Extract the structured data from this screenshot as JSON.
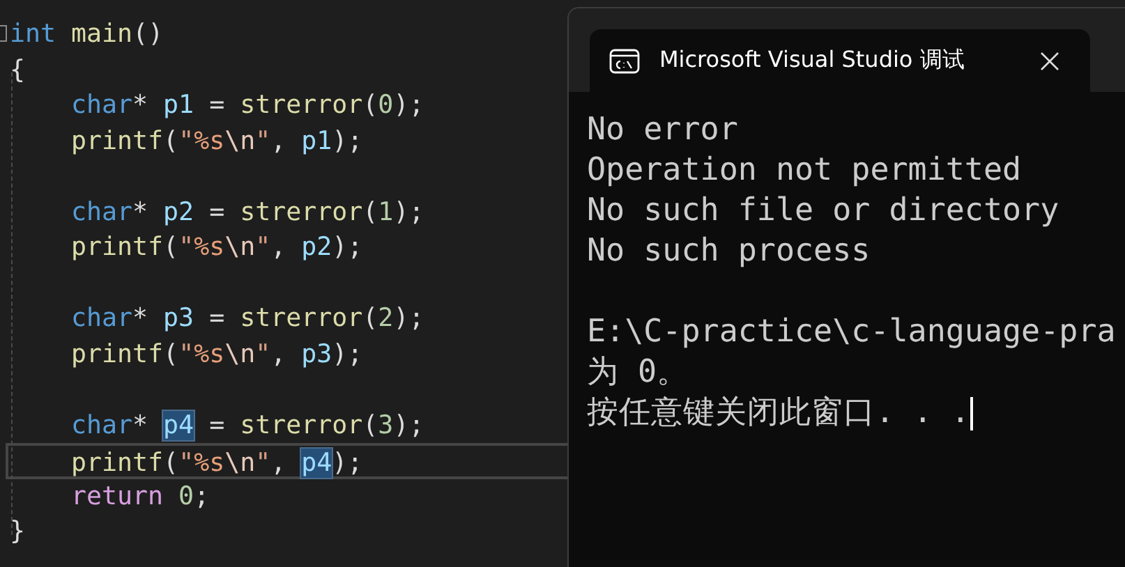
{
  "editor": {
    "function": {
      "header": [
        {
          "kind": "keyword",
          "text": "int "
        },
        {
          "kind": "function",
          "text": "main"
        },
        {
          "kind": "plain",
          "text": "()"
        }
      ],
      "open": "{",
      "body": [
        {
          "kind": "code",
          "current": false,
          "tokens": [
            {
              "kind": "keyword",
              "text": "char"
            },
            {
              "kind": "plain",
              "text": "* "
            },
            {
              "kind": "variable",
              "text": "p1",
              "highlighted": false
            },
            {
              "kind": "plain",
              "text": " = "
            },
            {
              "kind": "function",
              "text": "strerror"
            },
            {
              "kind": "plain",
              "text": "("
            },
            {
              "kind": "number",
              "text": "0"
            },
            {
              "kind": "plain",
              "text": ");"
            }
          ]
        },
        {
          "kind": "code",
          "current": false,
          "tokens": [
            {
              "kind": "function",
              "text": "printf"
            },
            {
              "kind": "plain",
              "text": "("
            },
            {
              "kind": "string",
              "text": "\""
            },
            {
              "kind": "format",
              "text": "%s"
            },
            {
              "kind": "escape",
              "text": "\\n"
            },
            {
              "kind": "string",
              "text": "\""
            },
            {
              "kind": "plain",
              "text": ", "
            },
            {
              "kind": "variable",
              "text": "p1",
              "highlighted": false
            },
            {
              "kind": "plain",
              "text": ");"
            }
          ]
        },
        {
          "kind": "blank"
        },
        {
          "kind": "code",
          "current": false,
          "tokens": [
            {
              "kind": "keyword",
              "text": "char"
            },
            {
              "kind": "plain",
              "text": "* "
            },
            {
              "kind": "variable",
              "text": "p2",
              "highlighted": false
            },
            {
              "kind": "plain",
              "text": " = "
            },
            {
              "kind": "function",
              "text": "strerror"
            },
            {
              "kind": "plain",
              "text": "("
            },
            {
              "kind": "number",
              "text": "1"
            },
            {
              "kind": "plain",
              "text": ");"
            }
          ]
        },
        {
          "kind": "code",
          "current": false,
          "tokens": [
            {
              "kind": "function",
              "text": "printf"
            },
            {
              "kind": "plain",
              "text": "("
            },
            {
              "kind": "string",
              "text": "\""
            },
            {
              "kind": "format",
              "text": "%s"
            },
            {
              "kind": "escape",
              "text": "\\n"
            },
            {
              "kind": "string",
              "text": "\""
            },
            {
              "kind": "plain",
              "text": ", "
            },
            {
              "kind": "variable",
              "text": "p2",
              "highlighted": false
            },
            {
              "kind": "plain",
              "text": ");"
            }
          ]
        },
        {
          "kind": "blank"
        },
        {
          "kind": "code",
          "current": false,
          "tokens": [
            {
              "kind": "keyword",
              "text": "char"
            },
            {
              "kind": "plain",
              "text": "* "
            },
            {
              "kind": "variable",
              "text": "p3",
              "highlighted": false
            },
            {
              "kind": "plain",
              "text": " = "
            },
            {
              "kind": "function",
              "text": "strerror"
            },
            {
              "kind": "plain",
              "text": "("
            },
            {
              "kind": "number",
              "text": "2"
            },
            {
              "kind": "plain",
              "text": ");"
            }
          ]
        },
        {
          "kind": "code",
          "current": false,
          "tokens": [
            {
              "kind": "function",
              "text": "printf"
            },
            {
              "kind": "plain",
              "text": "("
            },
            {
              "kind": "string",
              "text": "\""
            },
            {
              "kind": "format",
              "text": "%s"
            },
            {
              "kind": "escape",
              "text": "\\n"
            },
            {
              "kind": "string",
              "text": "\""
            },
            {
              "kind": "plain",
              "text": ", "
            },
            {
              "kind": "variable",
              "text": "p3",
              "highlighted": false
            },
            {
              "kind": "plain",
              "text": ");"
            }
          ]
        },
        {
          "kind": "blank"
        },
        {
          "kind": "code",
          "current": false,
          "tokens": [
            {
              "kind": "keyword",
              "text": "char"
            },
            {
              "kind": "plain",
              "text": "* "
            },
            {
              "kind": "variable",
              "text": "p4",
              "highlighted": true
            },
            {
              "kind": "plain",
              "text": " = "
            },
            {
              "kind": "function",
              "text": "strerror"
            },
            {
              "kind": "plain",
              "text": "("
            },
            {
              "kind": "number",
              "text": "3"
            },
            {
              "kind": "plain",
              "text": ");"
            }
          ]
        },
        {
          "kind": "code",
          "current": true,
          "tokens": [
            {
              "kind": "function",
              "text": "printf"
            },
            {
              "kind": "plain",
              "text": "("
            },
            {
              "kind": "string",
              "text": "\""
            },
            {
              "kind": "format",
              "text": "%s"
            },
            {
              "kind": "escape",
              "text": "\\n"
            },
            {
              "kind": "string",
              "text": "\""
            },
            {
              "kind": "plain",
              "text": ", "
            },
            {
              "kind": "variable",
              "text": "p4",
              "highlighted": true
            },
            {
              "kind": "plain",
              "text": ");"
            }
          ]
        },
        {
          "kind": "code",
          "current": false,
          "tokens": [
            {
              "kind": "control",
              "text": "return "
            },
            {
              "kind": "number",
              "text": "0"
            },
            {
              "kind": "plain",
              "text": ";"
            }
          ]
        }
      ],
      "close": "}"
    }
  },
  "terminal": {
    "tab": {
      "title": "Microsoft Visual Studio 调试"
    },
    "output": [
      "No error",
      "Operation not permitted",
      "No such file or directory",
      "No such process"
    ],
    "status": [
      "E:\\C-practice\\c-language-pra",
      "为 0。",
      "按任意键关闭此窗口. . ."
    ]
  }
}
